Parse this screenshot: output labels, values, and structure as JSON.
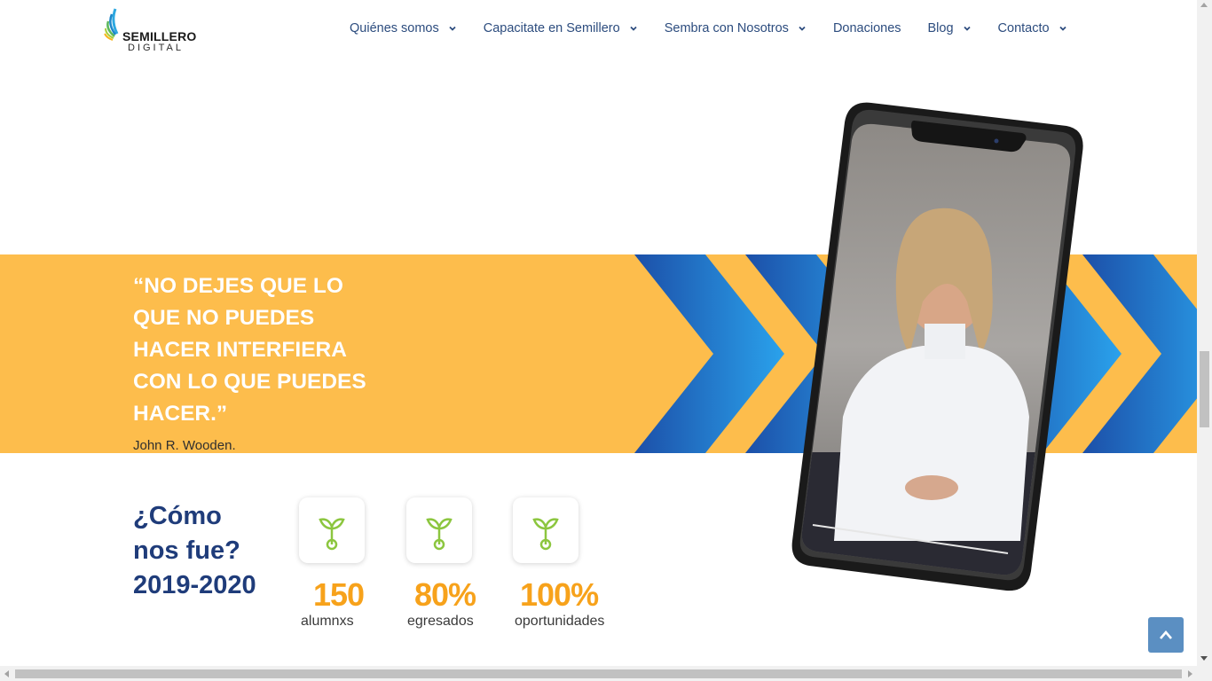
{
  "logo": {
    "main": "SEMILLERO",
    "sub": "DIGITAL"
  },
  "nav": [
    {
      "label": "Quiénes somos",
      "has_dropdown": true
    },
    {
      "label": "Capacitate en Semillero",
      "has_dropdown": true
    },
    {
      "label": "Sembra con Nosotros",
      "has_dropdown": true
    },
    {
      "label": "Donaciones",
      "has_dropdown": false
    },
    {
      "label": "Blog",
      "has_dropdown": true
    },
    {
      "label": "Contacto",
      "has_dropdown": true
    }
  ],
  "banner": {
    "quote": "“No dejes que lo que no puedes hacer interfiera con lo que puedes hacer.”",
    "author": "John R. Wooden."
  },
  "stats": {
    "title_line1": "¿Cómo",
    "title_line2": "nos fue?",
    "title_line3": "2019-2020",
    "items": [
      {
        "value": "150",
        "label": "alumnxs",
        "icon": "sprout-icon"
      },
      {
        "value": "80%",
        "label": "egresados",
        "icon": "sprout-icon"
      },
      {
        "value": "100%",
        "label": "oportunidades",
        "icon": "sprout-icon"
      }
    ]
  },
  "colors": {
    "banner": "#fdbd4c",
    "accent": "#f7a21b",
    "navy": "#1f3c7a",
    "chevron_blue": "#1e5fb8"
  },
  "scroll_to_top_icon": "chevron-up-icon"
}
